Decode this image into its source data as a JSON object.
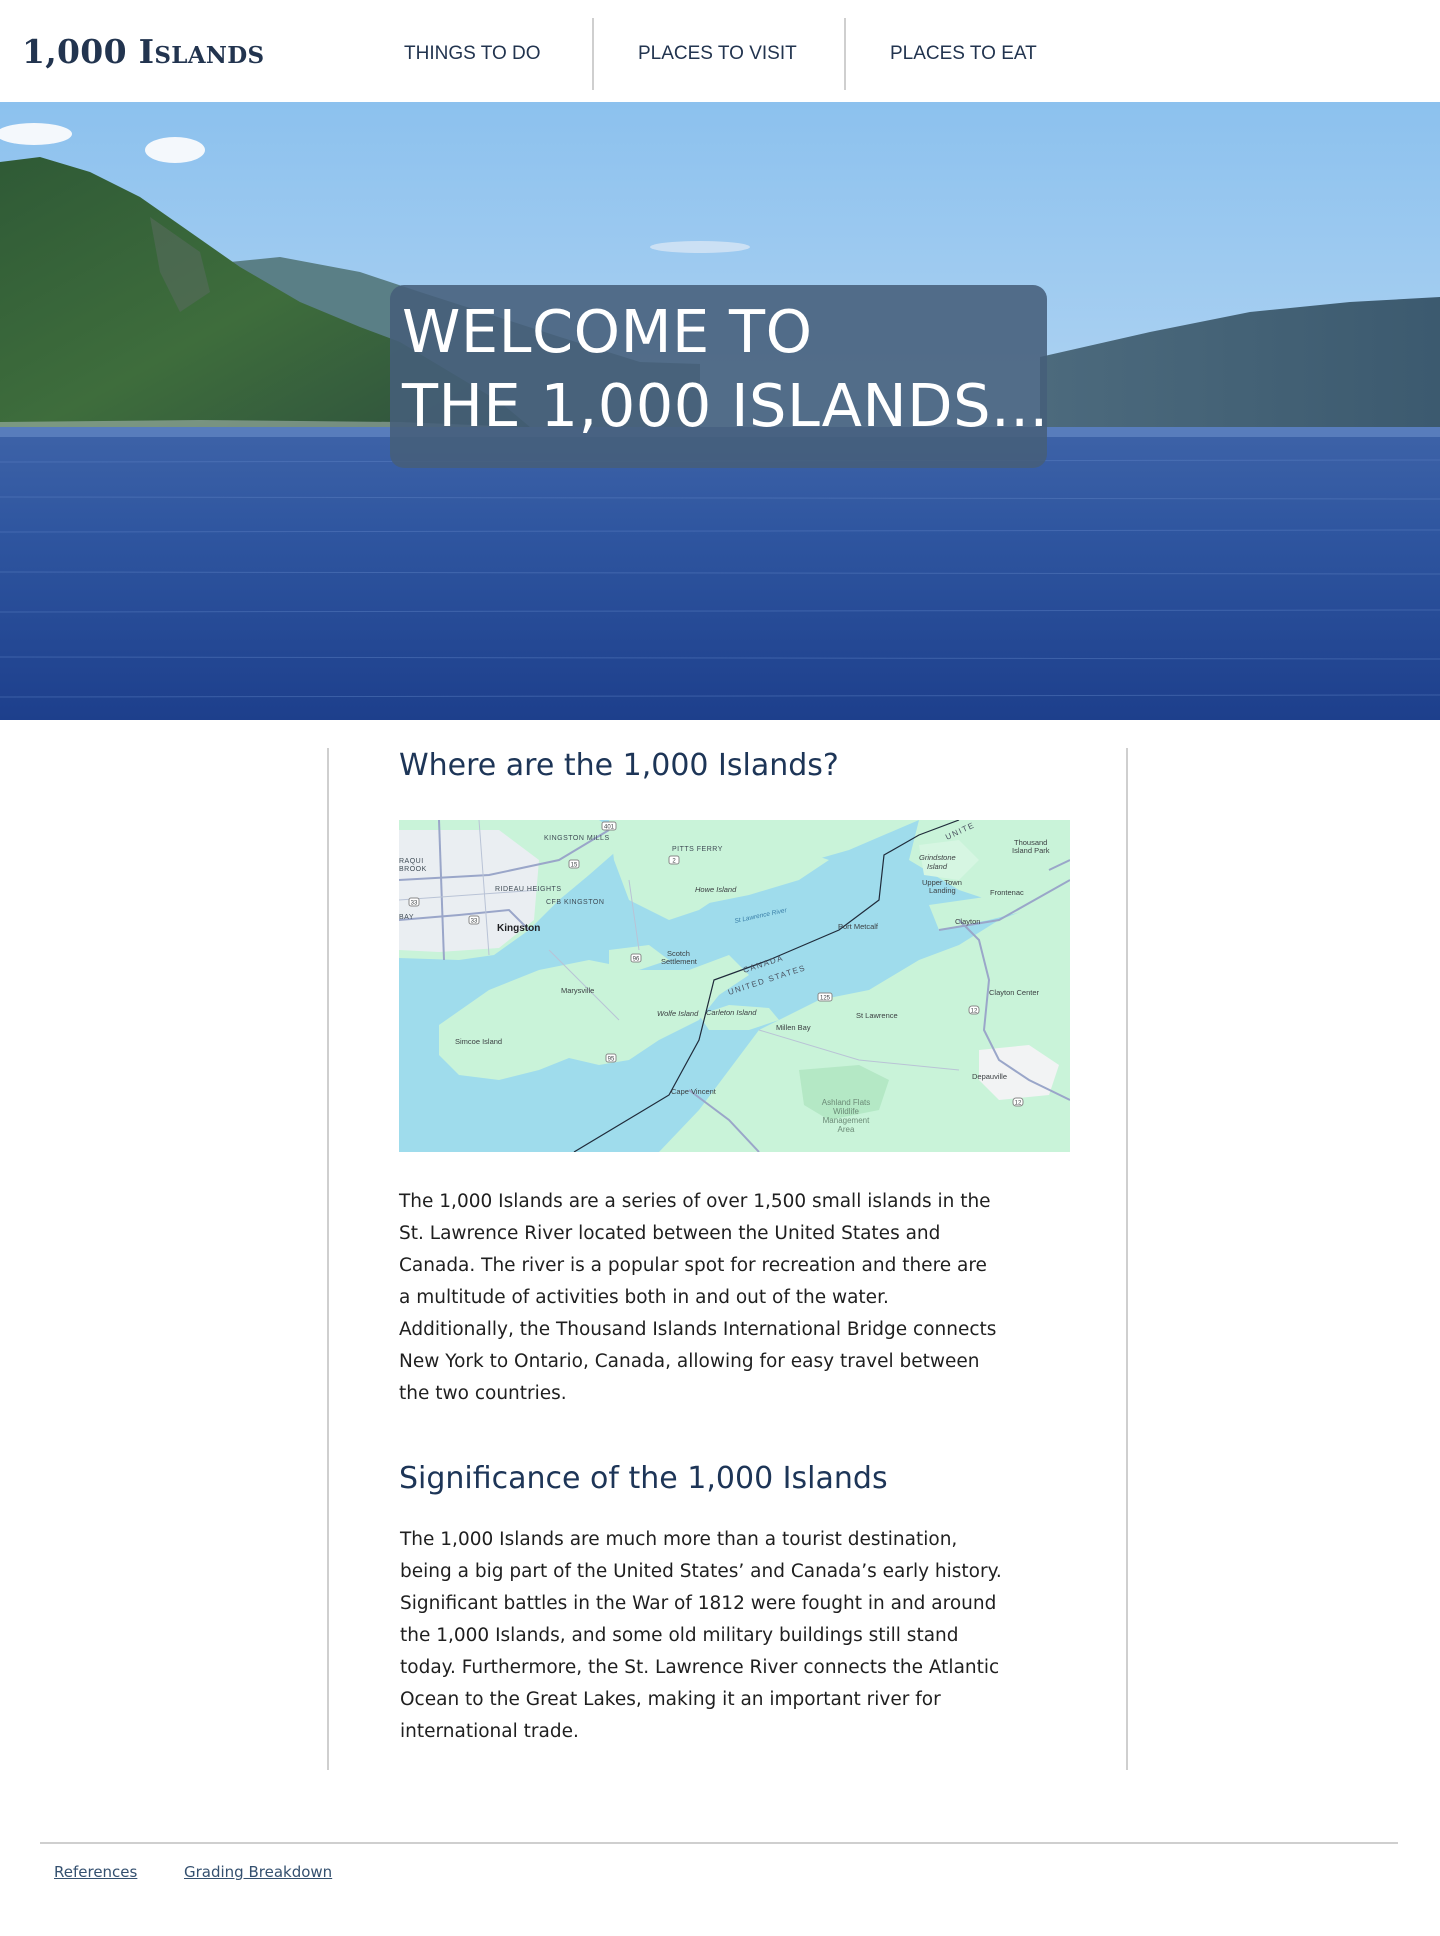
{
  "header": {
    "logo_prefix": "1,000 ",
    "logo_word": "Islands",
    "nav": [
      {
        "label": "THINGS TO DO"
      },
      {
        "label": "PLACES TO VISIT"
      },
      {
        "label": "PLACES TO EAT"
      }
    ]
  },
  "hero": {
    "line1": "WELCOME TO",
    "line2": "THE 1,000 ISLANDS..."
  },
  "sections": [
    {
      "title": "Where are the 1,000 Islands?",
      "body": "The 1,000 Islands are a series of over 1,500 small islands in the St. Lawrence River located between the United States and Canada. The river is a popular spot for recreation and there are a multitude of activities both in and out of the water. Additionally, the Thousand Islands International Bridge connects New York to Ontario, Canada, allowing for easy travel between the two countries."
    },
    {
      "title": "Significance of the 1,000 Islands",
      "body": "The 1,000 Islands are much more than a tourist destination, being a big part of the United States’ and Canada’s early history. Significant battles in the War of 1812 were fought in and around the 1,000 Islands, and some old military buildings still stand today. Furthermore, the St. Lawrence River connects the Atlantic Ocean to the Great Lakes, making it an important river for international trade."
    }
  ],
  "map": {
    "labels": {
      "kingston_mills": "KINGSTON MILLS",
      "pitts_ferry": "PITTS FERRY",
      "raqui_brook_1": "RAQUI",
      "raqui_brook_2": "BROOK",
      "rideau_heights": "RIDEAU HEIGHTS",
      "cfb_kingston": "CFB KINGSTON",
      "bay": "BAY",
      "kingston": "Kingston",
      "howe_island": "Howe Island",
      "st_lawrence_river": "St Lawrence River",
      "grindstone_1": "Grindstone",
      "grindstone_2": "Island",
      "upper_town_1": "Upper Town",
      "upper_town_2": "Landing",
      "thousand_island_park_1": "Thousand",
      "thousand_island_park_2": "Island Park",
      "frontenac": "Frontenac",
      "clayton": "Clayton",
      "port_metcalf": "Port Metcalf",
      "scotch_1": "Scotch",
      "scotch_2": "Settlement",
      "canada": "CANADA",
      "united_states": "UNITED STATES",
      "unite": "UNITE",
      "marysville": "Marysville",
      "wolfe_island": "Wolfe Island",
      "carleton_island": "Carleton Island",
      "millen_bay": "Millen Bay",
      "st_lawrence": "St Lawrence",
      "clayton_center": "Clayton Center",
      "simcoe_island": "Simcoe Island",
      "cape_vincent": "Cape Vincent",
      "depauville": "Depauville",
      "ashland_1": "Ashland Flats",
      "ashland_2": "Wildlife",
      "ashland_3": "Management",
      "ashland_4": "Area",
      "shield_401": "401",
      "shield_15": "15",
      "shield_2": "2",
      "shield_33a": "33",
      "shield_33b": "33",
      "shield_96": "96",
      "shield_95": "95",
      "shield_125": "125",
      "shield_12a": "12",
      "shield_12b": "12"
    }
  },
  "footer": {
    "links": [
      {
        "label": "References"
      },
      {
        "label": "Grading Breakdown"
      }
    ]
  },
  "colors": {
    "brand_navy": "#22344f",
    "heading_navy": "#1d3557",
    "hero_box": "#455e7a",
    "map_water": "#9fdcec",
    "map_land": "#c9f3d9",
    "divider": "#cfcfcf"
  }
}
